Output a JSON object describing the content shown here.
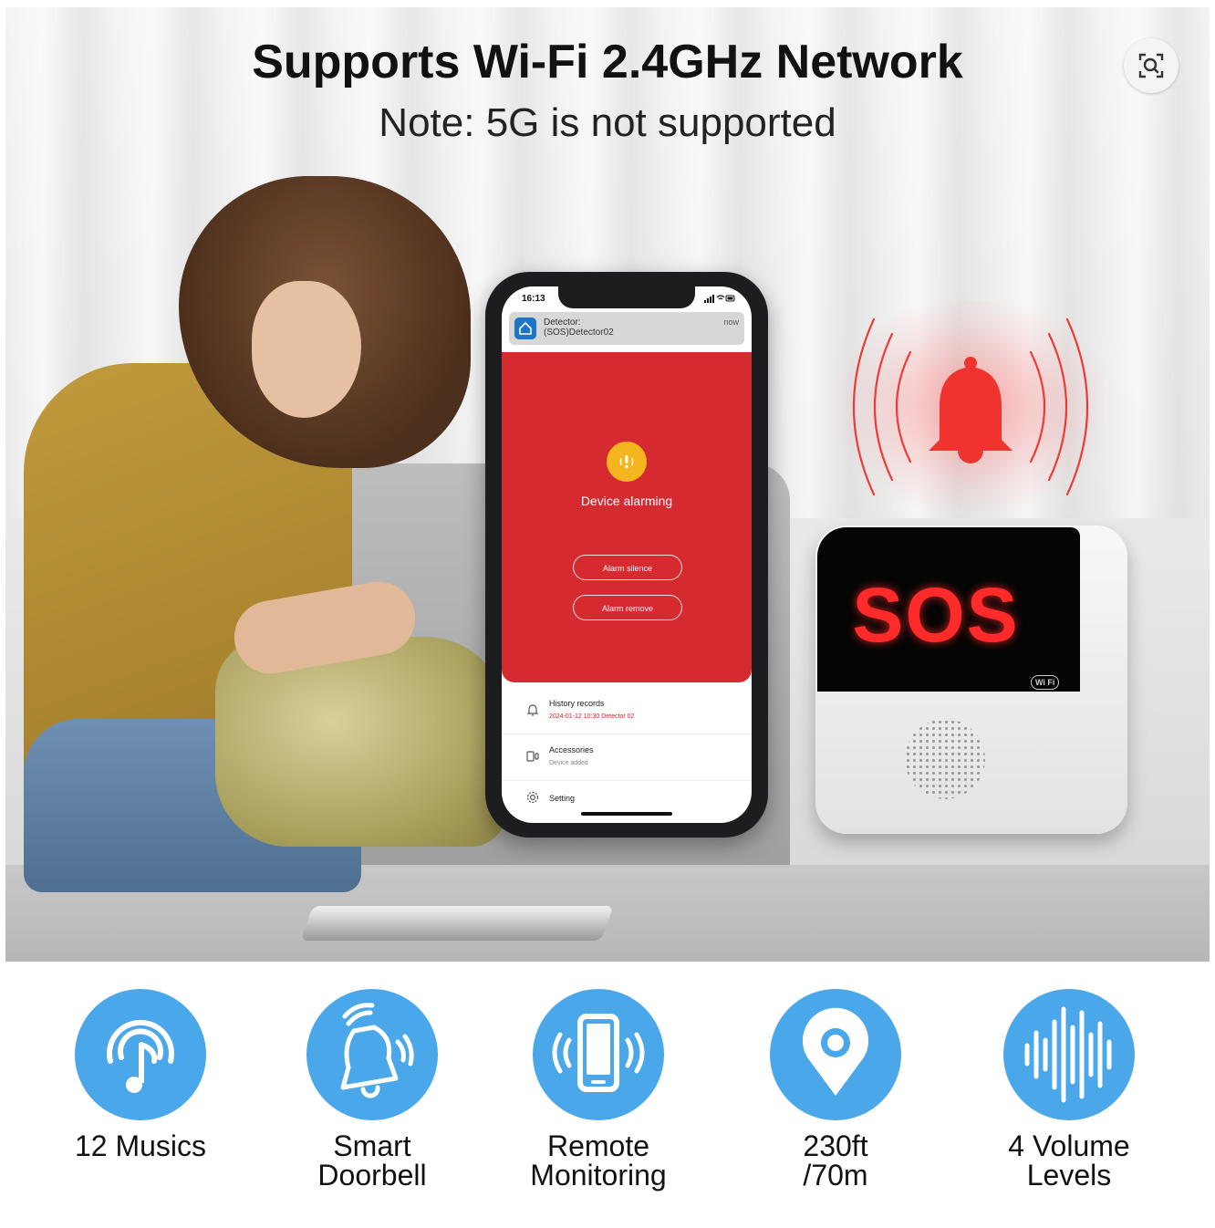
{
  "headline": "Supports Wi-Fi 2.4GHz Network",
  "subheadline": "Note: 5G is not supported",
  "lens_icon": "visual-search-icon",
  "phone": {
    "status_time": "16:13",
    "notification": {
      "title_line1": "Detector:",
      "title_line2": "(SOS)Detector02",
      "time": "now",
      "icon": "home-icon"
    },
    "alarm_text": "Device alarming",
    "buttons": [
      "Alarm silence",
      "Alarm remove"
    ],
    "list": [
      {
        "title": "History records",
        "subtitle": "2024-01-12 10:30 Detector 02",
        "icon": "bell-icon"
      },
      {
        "title": "Accessories",
        "subtitle": "Device added",
        "icon": "accessory-icon"
      },
      {
        "title": "Setting",
        "subtitle": "",
        "icon": "gear-icon"
      }
    ]
  },
  "device": {
    "display_text": "SOS",
    "badge": "Wi Fi"
  },
  "features": [
    {
      "label_line1": "12 Musics",
      "label_line2": "",
      "icon": "music-note-icon"
    },
    {
      "label_line1": "Smart",
      "label_line2": "Doorbell",
      "icon": "doorbell-icon"
    },
    {
      "label_line1": "Remote",
      "label_line2": "Monitoring",
      "icon": "smartphone-icon"
    },
    {
      "label_line1": "230ft",
      "label_line2": "/70m",
      "icon": "location-pin-icon"
    },
    {
      "label_line1": "4 Volume",
      "label_line2": "Levels",
      "icon": "sound-wave-icon"
    }
  ],
  "colors": {
    "feature_blue": "#4aa7e9",
    "alarm_red": "#d42a30",
    "bell_red": "#f0332e",
    "sos_red": "#ff2a2a"
  }
}
